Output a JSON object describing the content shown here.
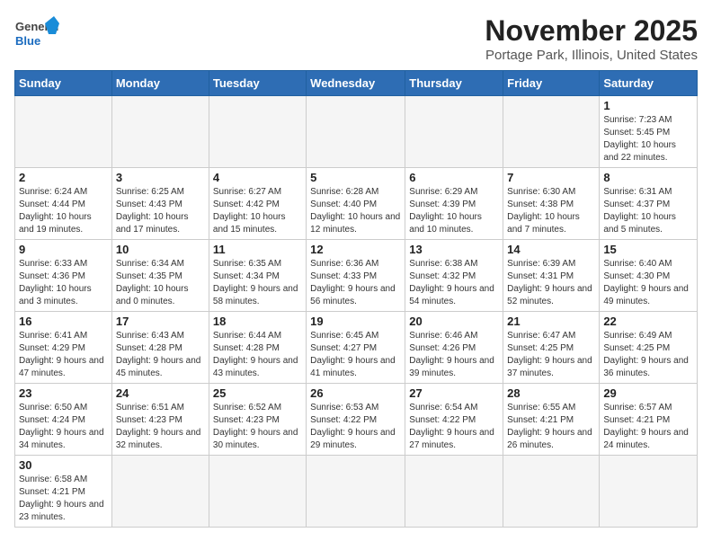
{
  "header": {
    "logo_general": "General",
    "logo_blue": "Blue",
    "month_title": "November 2025",
    "location": "Portage Park, Illinois, United States"
  },
  "weekdays": [
    "Sunday",
    "Monday",
    "Tuesday",
    "Wednesday",
    "Thursday",
    "Friday",
    "Saturday"
  ],
  "days": [
    {
      "num": "",
      "info": ""
    },
    {
      "num": "",
      "info": ""
    },
    {
      "num": "",
      "info": ""
    },
    {
      "num": "",
      "info": ""
    },
    {
      "num": "",
      "info": ""
    },
    {
      "num": "",
      "info": ""
    },
    {
      "num": "1",
      "info": "Sunrise: 7:23 AM\nSunset: 5:45 PM\nDaylight: 10 hours and 22 minutes."
    },
    {
      "num": "2",
      "info": "Sunrise: 6:24 AM\nSunset: 4:44 PM\nDaylight: 10 hours and 19 minutes."
    },
    {
      "num": "3",
      "info": "Sunrise: 6:25 AM\nSunset: 4:43 PM\nDaylight: 10 hours and 17 minutes."
    },
    {
      "num": "4",
      "info": "Sunrise: 6:27 AM\nSunset: 4:42 PM\nDaylight: 10 hours and 15 minutes."
    },
    {
      "num": "5",
      "info": "Sunrise: 6:28 AM\nSunset: 4:40 PM\nDaylight: 10 hours and 12 minutes."
    },
    {
      "num": "6",
      "info": "Sunrise: 6:29 AM\nSunset: 4:39 PM\nDaylight: 10 hours and 10 minutes."
    },
    {
      "num": "7",
      "info": "Sunrise: 6:30 AM\nSunset: 4:38 PM\nDaylight: 10 hours and 7 minutes."
    },
    {
      "num": "8",
      "info": "Sunrise: 6:31 AM\nSunset: 4:37 PM\nDaylight: 10 hours and 5 minutes."
    },
    {
      "num": "9",
      "info": "Sunrise: 6:33 AM\nSunset: 4:36 PM\nDaylight: 10 hours and 3 minutes."
    },
    {
      "num": "10",
      "info": "Sunrise: 6:34 AM\nSunset: 4:35 PM\nDaylight: 10 hours and 0 minutes."
    },
    {
      "num": "11",
      "info": "Sunrise: 6:35 AM\nSunset: 4:34 PM\nDaylight: 9 hours and 58 minutes."
    },
    {
      "num": "12",
      "info": "Sunrise: 6:36 AM\nSunset: 4:33 PM\nDaylight: 9 hours and 56 minutes."
    },
    {
      "num": "13",
      "info": "Sunrise: 6:38 AM\nSunset: 4:32 PM\nDaylight: 9 hours and 54 minutes."
    },
    {
      "num": "14",
      "info": "Sunrise: 6:39 AM\nSunset: 4:31 PM\nDaylight: 9 hours and 52 minutes."
    },
    {
      "num": "15",
      "info": "Sunrise: 6:40 AM\nSunset: 4:30 PM\nDaylight: 9 hours and 49 minutes."
    },
    {
      "num": "16",
      "info": "Sunrise: 6:41 AM\nSunset: 4:29 PM\nDaylight: 9 hours and 47 minutes."
    },
    {
      "num": "17",
      "info": "Sunrise: 6:43 AM\nSunset: 4:28 PM\nDaylight: 9 hours and 45 minutes."
    },
    {
      "num": "18",
      "info": "Sunrise: 6:44 AM\nSunset: 4:28 PM\nDaylight: 9 hours and 43 minutes."
    },
    {
      "num": "19",
      "info": "Sunrise: 6:45 AM\nSunset: 4:27 PM\nDaylight: 9 hours and 41 minutes."
    },
    {
      "num": "20",
      "info": "Sunrise: 6:46 AM\nSunset: 4:26 PM\nDaylight: 9 hours and 39 minutes."
    },
    {
      "num": "21",
      "info": "Sunrise: 6:47 AM\nSunset: 4:25 PM\nDaylight: 9 hours and 37 minutes."
    },
    {
      "num": "22",
      "info": "Sunrise: 6:49 AM\nSunset: 4:25 PM\nDaylight: 9 hours and 36 minutes."
    },
    {
      "num": "23",
      "info": "Sunrise: 6:50 AM\nSunset: 4:24 PM\nDaylight: 9 hours and 34 minutes."
    },
    {
      "num": "24",
      "info": "Sunrise: 6:51 AM\nSunset: 4:23 PM\nDaylight: 9 hours and 32 minutes."
    },
    {
      "num": "25",
      "info": "Sunrise: 6:52 AM\nSunset: 4:23 PM\nDaylight: 9 hours and 30 minutes."
    },
    {
      "num": "26",
      "info": "Sunrise: 6:53 AM\nSunset: 4:22 PM\nDaylight: 9 hours and 29 minutes."
    },
    {
      "num": "27",
      "info": "Sunrise: 6:54 AM\nSunset: 4:22 PM\nDaylight: 9 hours and 27 minutes."
    },
    {
      "num": "28",
      "info": "Sunrise: 6:55 AM\nSunset: 4:21 PM\nDaylight: 9 hours and 26 minutes."
    },
    {
      "num": "29",
      "info": "Sunrise: 6:57 AM\nSunset: 4:21 PM\nDaylight: 9 hours and 24 minutes."
    },
    {
      "num": "30",
      "info": "Sunrise: 6:58 AM\nSunset: 4:21 PM\nDaylight: 9 hours and 23 minutes."
    },
    {
      "num": "",
      "info": ""
    },
    {
      "num": "",
      "info": ""
    },
    {
      "num": "",
      "info": ""
    },
    {
      "num": "",
      "info": ""
    },
    {
      "num": "",
      "info": ""
    },
    {
      "num": "",
      "info": ""
    }
  ]
}
